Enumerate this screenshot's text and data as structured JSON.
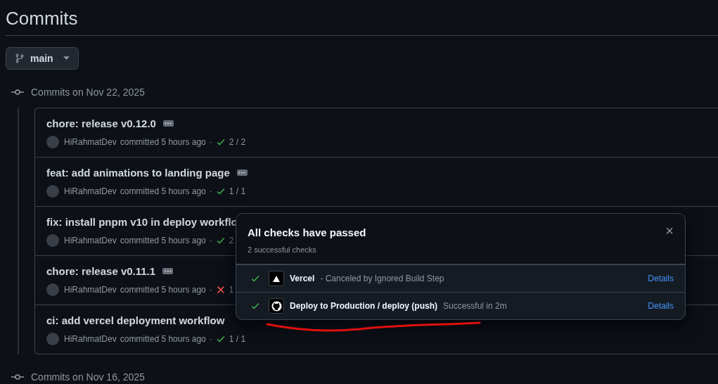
{
  "page_title": "Commits",
  "branch_button": {
    "label": "main"
  },
  "groups": [
    {
      "heading": "Commits on Nov 22, 2025",
      "commits": [
        {
          "title": "chore: release v0.12.0",
          "has_description": true,
          "author": "HiRahmatDev",
          "meta": "committed 5 hours ago",
          "separator": "·",
          "passed": true,
          "count": "2 / 2"
        },
        {
          "title": "feat: add animations to landing page",
          "has_description": true,
          "author": "HiRahmatDev",
          "meta": "committed 5 hours ago",
          "separator": "·",
          "passed": true,
          "count": "1 / 1"
        },
        {
          "title": "fix: install pnpm v10 in deploy workflo",
          "author": "HiRahmatDev",
          "meta": "committed 5 hours ago",
          "separator": "·",
          "passed": true,
          "count": "2"
        },
        {
          "title": "chore: release v0.11.1",
          "has_description": true,
          "author": "HiRahmatDev",
          "meta": "committed 5 hours ago",
          "separator": "·",
          "passed": false,
          "count": "1"
        },
        {
          "title": "ci: add vercel deployment workflow",
          "has_description": false,
          "author": "HiRahmatDev",
          "meta": "committed 5 hours ago",
          "separator": "·",
          "passed": true,
          "count": "1 / 1"
        }
      ]
    },
    {
      "heading": "Commits on Nov 16, 2025"
    }
  ],
  "checks_popover": {
    "title": "All checks have passed",
    "subtitle": "2 successful checks",
    "close": "×",
    "checks": [
      {
        "kind": "vercel",
        "passed": true,
        "name": "Vercel",
        "description": "- Canceled by Ignored Build Step",
        "link": "Details"
      },
      {
        "kind": "github",
        "passed": true,
        "name": "Deploy to Production / deploy (push)",
        "description": "Successful in 2m",
        "link": "Details"
      }
    ]
  }
}
